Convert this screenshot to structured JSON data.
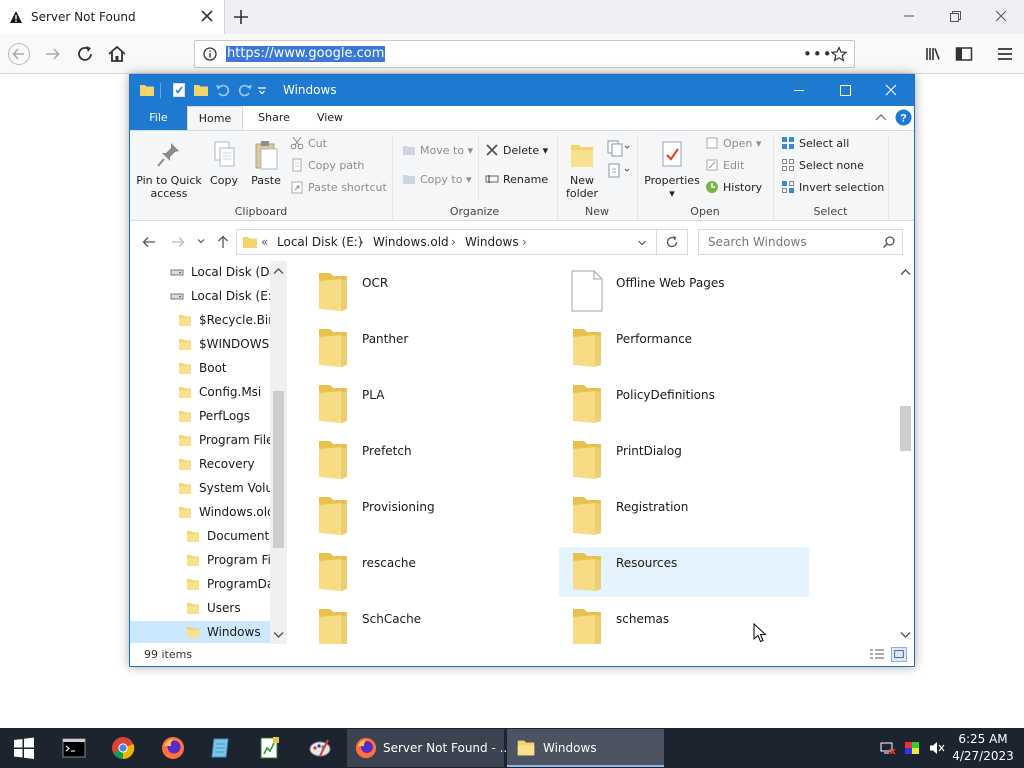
{
  "browser": {
    "tab_title": "Server Not Found",
    "url": "https://www.google.com"
  },
  "explorer": {
    "window_title": "Windows",
    "ribbon_tabs": [
      "File",
      "Home",
      "Share",
      "View"
    ],
    "clipboard": {
      "pin": "Pin to Quick access",
      "pin_line1": "Pin to Quick",
      "pin_line2": "access",
      "copy": "Copy",
      "paste": "Paste",
      "cut": "Cut",
      "copy_path": "Copy path",
      "paste_shortcut": "Paste shortcut",
      "label": "Clipboard"
    },
    "organize": {
      "move_to": "Move to",
      "copy_to": "Copy to",
      "delete": "Delete",
      "rename": "Rename",
      "label": "Organize"
    },
    "new": {
      "new_folder_line1": "New",
      "new_folder_line2": "folder",
      "label": "New"
    },
    "open": {
      "properties": "Properties",
      "open": "Open",
      "edit": "Edit",
      "history": "History",
      "label": "Open"
    },
    "select": {
      "select_all": "Select all",
      "select_none": "Select none",
      "invert": "Invert selection",
      "label": "Select"
    },
    "breadcrumb": [
      "Local Disk (E:)",
      "Windows.old",
      "Windows"
    ],
    "breadcrumb_prefix": "«",
    "search_placeholder": "Search Windows",
    "tree": [
      {
        "label": "Local Disk (D:)",
        "type": "drive"
      },
      {
        "label": "Local Disk (E:)",
        "type": "drive"
      },
      {
        "label": "$Recycle.Bin",
        "type": "folder"
      },
      {
        "label": "$WINDOWS.~",
        "type": "folder"
      },
      {
        "label": "Boot",
        "type": "folder"
      },
      {
        "label": "Config.Msi",
        "type": "folder"
      },
      {
        "label": "PerfLogs",
        "type": "folder"
      },
      {
        "label": "Program Files",
        "type": "folder"
      },
      {
        "label": "Recovery",
        "type": "folder"
      },
      {
        "label": "System Volume",
        "type": "folder"
      },
      {
        "label": "Windows.old",
        "type": "folder"
      },
      {
        "label": "Documents",
        "type": "folder"
      },
      {
        "label": "Program Fil",
        "type": "folder"
      },
      {
        "label": "ProgramDat",
        "type": "folder"
      },
      {
        "label": "Users",
        "type": "folder"
      },
      {
        "label": "Windows",
        "type": "folder",
        "selected": true
      }
    ],
    "files": [
      {
        "label": "OCR",
        "kind": "folder"
      },
      {
        "label": "Offline Web Pages",
        "kind": "file"
      },
      {
        "label": "Panther",
        "kind": "folder"
      },
      {
        "label": "Performance",
        "kind": "folder"
      },
      {
        "label": "PLA",
        "kind": "folder"
      },
      {
        "label": "PolicyDefinitions",
        "kind": "folder"
      },
      {
        "label": "Prefetch",
        "kind": "folder"
      },
      {
        "label": "PrintDialog",
        "kind": "folder"
      },
      {
        "label": "Provisioning",
        "kind": "folder"
      },
      {
        "label": "Registration",
        "kind": "folder"
      },
      {
        "label": "rescache",
        "kind": "folder"
      },
      {
        "label": "Resources",
        "kind": "folder",
        "hover": true
      },
      {
        "label": "SchCache",
        "kind": "folder"
      },
      {
        "label": "schemas",
        "kind": "folder"
      }
    ],
    "status": "99 items"
  },
  "taskbar": {
    "tasks": [
      "Server Not Found - ...",
      "Windows"
    ],
    "time": "6:25 AM",
    "date": "4/27/2023"
  },
  "colors": {
    "accent": "#1e7ad0",
    "folder": "#f4d36b",
    "taskbar": "#1c2430"
  }
}
